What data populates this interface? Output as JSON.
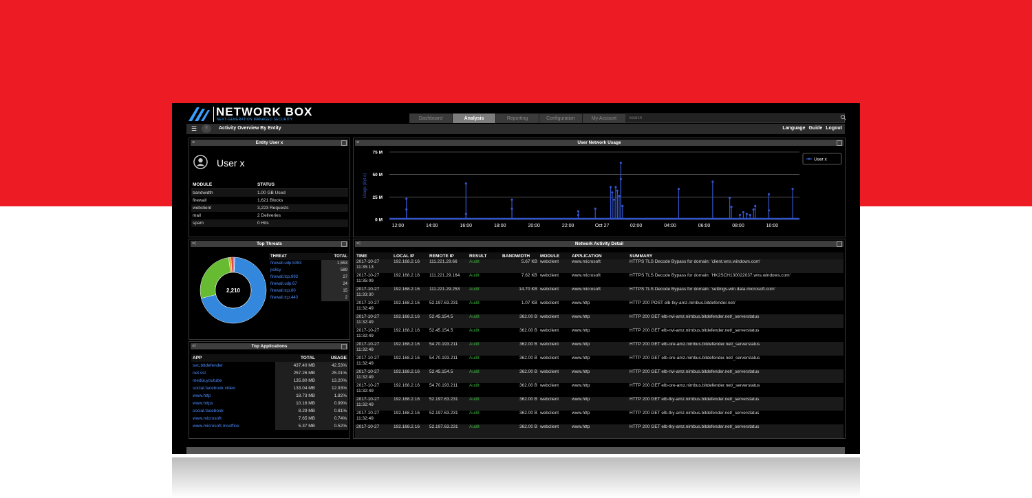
{
  "brand": {
    "title": "NETWORK BOX",
    "subtitle": "NEXT-GENERATION MANAGED SECURITY"
  },
  "tabs": [
    {
      "label": "Dashboard",
      "active": false
    },
    {
      "label": "Analysis",
      "active": true
    },
    {
      "label": "Reporting",
      "active": false
    },
    {
      "label": "Configuration",
      "active": false
    },
    {
      "label": "My Account",
      "active": false
    }
  ],
  "search": {
    "placeholder": "Search",
    "value": ""
  },
  "page": {
    "title": "Activity Overview By Entity"
  },
  "top_links": [
    "Language",
    "Guide",
    "Logout"
  ],
  "entity": {
    "panel_title": "Entity User x",
    "user_name": "User x",
    "headers": [
      "MODULE",
      "STATUS"
    ],
    "rows": [
      {
        "module": "bandwidth",
        "status": "1.00 GB Used"
      },
      {
        "module": "firewall",
        "status": "1,621 Blocks"
      },
      {
        "module": "webclient",
        "status": "3,223 Requests"
      },
      {
        "module": "mail",
        "status": "2 Deliveries"
      },
      {
        "module": "spam",
        "status": "0 Hits"
      }
    ]
  },
  "threats": {
    "panel_title": "Top Threats",
    "total": "2,210",
    "headers": [
      "THREAT",
      "TOTAL"
    ],
    "rows": [
      {
        "threat": "firewall.udp.5353",
        "total": "1,553"
      },
      {
        "threat": "policy",
        "total": "589"
      },
      {
        "threat": "firewall.tcp.993",
        "total": "27"
      },
      {
        "threat": "firewall.udp.67",
        "total": "24"
      },
      {
        "threat": "firewall.tcp.80",
        "total": "15"
      },
      {
        "threat": "firewall.tcp.443",
        "total": "2"
      }
    ],
    "colors": [
      "#3388dd",
      "#66bb33",
      "#e8a33a",
      "#cc3333",
      "#9966cc",
      "#dddddd"
    ]
  },
  "apps": {
    "panel_title": "Top Applications",
    "headers": [
      "APP",
      "TOTAL",
      "USAGE"
    ],
    "rows": [
      {
        "app": "svc.bitdefender",
        "total": "437.40 MB",
        "usage": "42.53%"
      },
      {
        "app": "net.ssl",
        "total": "257.26 MB",
        "usage": "25.01%"
      },
      {
        "app": "media.youtube",
        "total": "135.80 MB",
        "usage": "13.20%"
      },
      {
        "app": "social.facebook.video",
        "total": "133.04 MB",
        "usage": "12.93%"
      },
      {
        "app": "www.http",
        "total": "18.73 MB",
        "usage": "1.82%"
      },
      {
        "app": "www.https",
        "total": "10.16 MB",
        "usage": "0.99%"
      },
      {
        "app": "social.facebook",
        "total": "8.29 MB",
        "usage": "0.81%"
      },
      {
        "app": "www.microsoft",
        "total": "7.65 MB",
        "usage": "0.74%"
      },
      {
        "app": "www.microsoft.msoffice",
        "total": "5.37 MB",
        "usage": "0.52%"
      }
    ]
  },
  "usage": {
    "panel_title": "User Network Usage",
    "ylabel": "Usage (Byt e)",
    "legend": "User x",
    "color": "#3355cc",
    "y_ticks": [
      "75 M",
      "50 M",
      "25 M",
      "0 M"
    ],
    "y_values": [
      75,
      50,
      25,
      0
    ],
    "ylim": [
      0,
      75
    ],
    "x_ticks": [
      "12:00",
      "14:00",
      "16:00",
      "18:00",
      "20:00",
      "22:00",
      "Oct 27",
      "02:00",
      "04:00",
      "06:00",
      "08:00",
      "10:00"
    ],
    "x_hours": [
      12,
      14,
      16,
      18,
      20,
      22,
      24,
      26,
      28,
      30,
      32,
      34
    ],
    "xlim": [
      11.5,
      35.6
    ],
    "spikes": [
      [
        12.5,
        23
      ],
      [
        12.5,
        11
      ],
      [
        16.0,
        40
      ],
      [
        16.0,
        6
      ],
      [
        18.7,
        22
      ],
      [
        18.7,
        12
      ],
      [
        22.6,
        9
      ],
      [
        22.6,
        5
      ],
      [
        23.6,
        12
      ],
      [
        24.5,
        36
      ],
      [
        24.6,
        30
      ],
      [
        24.7,
        22
      ],
      [
        24.8,
        36
      ],
      [
        24.9,
        32
      ],
      [
        25.0,
        26
      ],
      [
        25.1,
        63
      ],
      [
        25.1,
        45
      ],
      [
        25.2,
        15
      ],
      [
        28.5,
        34
      ],
      [
        30.5,
        42
      ],
      [
        31.5,
        24
      ],
      [
        31.6,
        14
      ],
      [
        32.1,
        5
      ],
      [
        32.3,
        8
      ],
      [
        32.5,
        6
      ],
      [
        32.7,
        5
      ],
      [
        32.9,
        11
      ],
      [
        33.0,
        15
      ],
      [
        33.8,
        28
      ],
      [
        33.8,
        10
      ],
      [
        35.2,
        34
      ]
    ]
  },
  "network": {
    "panel_title": "Network Activity Detail",
    "headers": [
      "TIME",
      "LOCAL IP",
      "REMOTE IP",
      "RESULT",
      "BANDWIDTH",
      "MODULE",
      "APPLICATION",
      "SUMMARY"
    ],
    "rows": [
      {
        "date": "2017-10-27",
        "clock": "11:35:13",
        "local": "192.168.2.16",
        "remote": "111.221.29.66",
        "result": "Audit",
        "bw": "5.67 KB",
        "module": "webclient",
        "app": "www.microsoft",
        "summary": "HTTPS TLS Decode Bypass for domain: 'client.wns.windows.com'"
      },
      {
        "date": "2017-10-27",
        "clock": "11:35:09",
        "local": "192.168.2.16",
        "remote": "111.221.29.164",
        "result": "Audit",
        "bw": "7.62 KB",
        "module": "webclient",
        "app": "www.microsoft",
        "summary": "HTTPS TLS Decode Bypass for domain: 'HK2SCH130022037.wns.windows.com'"
      },
      {
        "date": "2017-10-27",
        "clock": "11:33:30",
        "local": "192.168.2.16",
        "remote": "111.221.29.253",
        "result": "Audit",
        "bw": "14.70 KB",
        "module": "webclient",
        "app": "www.microsoft",
        "summary": "HTTPS TLS Decode Bypass for domain: 'settings-win.data.microsoft.com'"
      },
      {
        "date": "2017-10-27",
        "clock": "11:32:49",
        "local": "192.168.2.16",
        "remote": "52.197.63.231",
        "result": "Audit",
        "bw": "1.07 KB",
        "module": "webclient",
        "app": "www.http",
        "summary": "HTTP 200 POST elb-tky-amz.nimbus.bitdefender.net/"
      },
      {
        "date": "2017-10-27",
        "clock": "11:32:49",
        "local": "192.168.2.16",
        "remote": "52.45.154.5",
        "result": "Audit",
        "bw": "362.00 B",
        "module": "webclient",
        "app": "www.http",
        "summary": "HTTP 200 GET elb-nvi-amz.nimbus.bitdefender.net/_serverstatus"
      },
      {
        "date": "2017-10-27",
        "clock": "11:32:49",
        "local": "192.168.2.16",
        "remote": "52.45.154.5",
        "result": "Audit",
        "bw": "362.00 B",
        "module": "webclient",
        "app": "www.http",
        "summary": "HTTP 200 GET elb-nvi-amz.nimbus.bitdefender.net/_serverstatus"
      },
      {
        "date": "2017-10-27",
        "clock": "11:32:49",
        "local": "192.168.2.16",
        "remote": "54.70.193.211",
        "result": "Audit",
        "bw": "362.00 B",
        "module": "webclient",
        "app": "www.http",
        "summary": "HTTP 200 GET elb-ore-amz.nimbus.bitdefender.net/_serverstatus"
      },
      {
        "date": "2017-10-27",
        "clock": "11:32:49",
        "local": "192.168.2.16",
        "remote": "54.70.193.211",
        "result": "Audit",
        "bw": "362.00 B",
        "module": "webclient",
        "app": "www.http",
        "summary": "HTTP 200 GET elb-ore-amz.nimbus.bitdefender.net/_serverstatus"
      },
      {
        "date": "2017-10-27",
        "clock": "11:32:49",
        "local": "192.168.2.16",
        "remote": "52.45.154.5",
        "result": "Audit",
        "bw": "362.00 B",
        "module": "webclient",
        "app": "www.http",
        "summary": "HTTP 200 GET elb-nvi-amz.nimbus.bitdefender.net/_serverstatus"
      },
      {
        "date": "2017-10-27",
        "clock": "11:32:49",
        "local": "192.168.2.16",
        "remote": "54.70.193.211",
        "result": "Audit",
        "bw": "362.00 B",
        "module": "webclient",
        "app": "www.http",
        "summary": "HTTP 200 GET elb-ore-amz.nimbus.bitdefender.net/_serverstatus"
      },
      {
        "date": "2017-10-27",
        "clock": "11:32:49",
        "local": "192.168.2.16",
        "remote": "52.197.63.231",
        "result": "Audit",
        "bw": "362.00 B",
        "module": "webclient",
        "app": "www.http",
        "summary": "HTTP 200 GET elb-tky-amz.nimbus.bitdefender.net/_serverstatus"
      },
      {
        "date": "2017-10-27",
        "clock": "11:32:49",
        "local": "192.168.2.16",
        "remote": "52.197.63.231",
        "result": "Audit",
        "bw": "362.00 B",
        "module": "webclient",
        "app": "www.http",
        "summary": "HTTP 200 GET elb-tky-amz.nimbus.bitdefender.net/_serverstatus"
      },
      {
        "date": "2017-10-27",
        "clock": "",
        "local": "192.168.2.16",
        "remote": "52.197.63.231",
        "result": "Audit",
        "bw": "362.00 B",
        "module": "webclient",
        "app": "www.http",
        "summary": "HTTP 200 GET elb-tky-amz.nimbus.bitdefender.net/_serverstatus"
      }
    ]
  }
}
